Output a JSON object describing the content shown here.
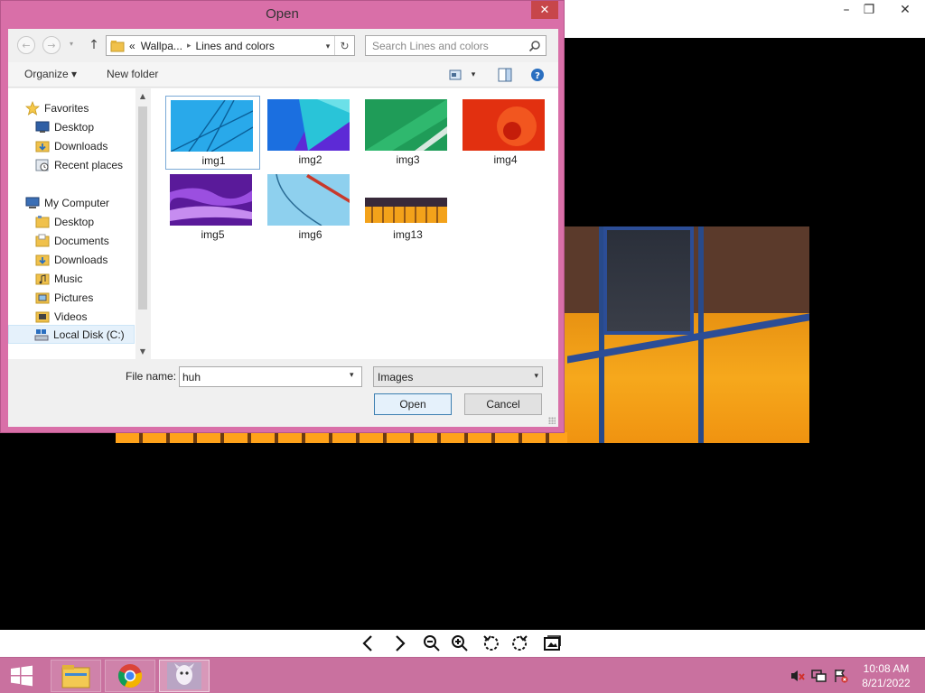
{
  "dialog": {
    "title": "Open",
    "close_glyph": "✕",
    "breadcrumb": [
      "Wallpa...",
      "Lines and colors"
    ],
    "breadcrumb_prefix": "«",
    "search_placeholder": "Search Lines and colors",
    "toolbar": {
      "organize": "Organize ▾",
      "new_folder": "New folder"
    },
    "nav_tree": [
      {
        "label": "Favorites",
        "icon": "star-icon"
      },
      {
        "label": "Desktop",
        "icon": "desktop-icon"
      },
      {
        "label": "Downloads",
        "icon": "downloads-folder-icon"
      },
      {
        "label": "Recent places",
        "icon": "recent-places-icon"
      },
      {
        "label": "My Computer",
        "icon": "computer-icon"
      },
      {
        "label": "Desktop",
        "icon": "folder-icon"
      },
      {
        "label": "Documents",
        "icon": "folder-icon"
      },
      {
        "label": "Downloads",
        "icon": "folder-icon"
      },
      {
        "label": "Music",
        "icon": "folder-icon"
      },
      {
        "label": "Pictures",
        "icon": "folder-icon"
      },
      {
        "label": "Videos",
        "icon": "folder-icon"
      },
      {
        "label": "Local Disk (C:)",
        "icon": "drive-icon",
        "selected": true
      }
    ],
    "files": [
      {
        "label": "img1",
        "selected": true
      },
      {
        "label": "img2"
      },
      {
        "label": "img3"
      },
      {
        "label": "img4"
      },
      {
        "label": "img5"
      },
      {
        "label": "img6"
      },
      {
        "label": "img13"
      }
    ],
    "file_name_label": "File name:",
    "file_name_value": "huh",
    "file_type": "Images",
    "open_button": "Open",
    "cancel_button": "Cancel"
  },
  "viewer": {
    "window_controls": {
      "minimize": "–",
      "maximize": "❐",
      "close": "✕"
    },
    "toolbar_icons": [
      "previous-icon",
      "next-icon",
      "zoom-out-icon",
      "zoom-in-icon",
      "rotate-left-icon",
      "rotate-right-icon",
      "open-folder-icon"
    ]
  },
  "taskbar": {
    "time": "10:08 AM",
    "date": "8/21/2022",
    "apps": [
      "file-explorer-icon",
      "chrome-icon",
      "image-viewer-icon"
    ]
  },
  "colors": {
    "dialog_frame": "#d96fa8",
    "taskbar": "#c9719f",
    "selection": "#e5f1fb"
  }
}
